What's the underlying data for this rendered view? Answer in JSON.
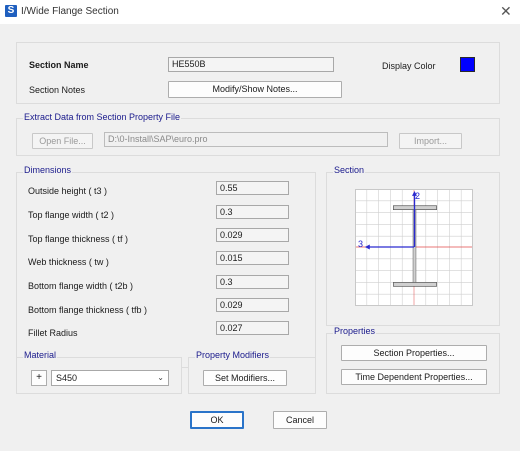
{
  "window": {
    "title": "I/Wide Flange Section",
    "app_icon": "S"
  },
  "section": {
    "name_label": "Section Name",
    "name_value": "HE550B",
    "notes_label": "Section Notes",
    "notes_button": "Modify/Show Notes...",
    "display_color_label": "Display Color",
    "display_color": "#0000ff"
  },
  "extract": {
    "group_label": "Extract Data from Section Property File",
    "open_button": "Open File...",
    "file_path": "D:\\0-Install\\SAP\\euro.pro",
    "import_button": "Import..."
  },
  "dimensions": {
    "group_label": "Dimensions",
    "rows": [
      {
        "label": "Outside height  ( t3 )",
        "value": "0.55"
      },
      {
        "label": "Top flange width  ( t2 )",
        "value": "0.3"
      },
      {
        "label": "Top flange thickness  ( tf )",
        "value": "0.029"
      },
      {
        "label": "Web thickness  ( tw )",
        "value": "0.015"
      },
      {
        "label": "Bottom flange width  ( t2b )",
        "value": "0.3"
      },
      {
        "label": "Bottom flange thickness  ( tfb )",
        "value": "0.029"
      },
      {
        "label": "Fillet Radius",
        "value": "0.027"
      }
    ]
  },
  "section_preview": {
    "group_label": "Section",
    "axis2": "2",
    "axis3": "3",
    "axis_color": "#3b3bd6",
    "horiz_axis_color": "#e04a4a"
  },
  "properties": {
    "group_label": "Properties",
    "section_button": "Section Properties...",
    "time_button": "Time Dependent Properties..."
  },
  "material": {
    "group_label": "Material",
    "plus": "+",
    "selected": "S450"
  },
  "modifiers": {
    "group_label": "Property Modifiers",
    "button": "Set Modifiers..."
  },
  "footer": {
    "ok": "OK",
    "cancel": "Cancel"
  }
}
